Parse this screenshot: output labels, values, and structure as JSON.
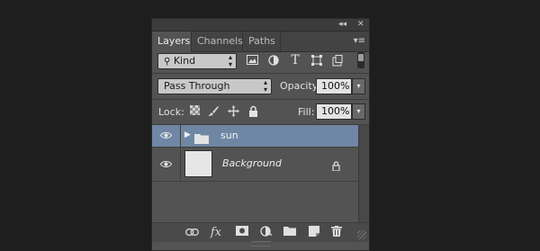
{
  "panel": {
    "title_controls": {
      "collapse": "◂◂",
      "close": "✕"
    },
    "tabs": [
      {
        "label": "Layers",
        "active": true
      },
      {
        "label": "Channels",
        "active": false
      },
      {
        "label": "Paths",
        "active": false
      }
    ],
    "menu_icon": "≡"
  },
  "filter": {
    "kind_label": "Kind",
    "icons": [
      "image-filter-icon",
      "adjustment-filter-icon",
      "type-filter-icon",
      "shape-filter-icon",
      "smart-object-filter-icon",
      "filter-toggle-icon"
    ]
  },
  "blend": {
    "mode": "Pass Through",
    "opacity_label": "Opacity:",
    "opacity_value": "100%"
  },
  "lock": {
    "label": "Lock:",
    "fill_label": "Fill:",
    "fill_value": "100%"
  },
  "layers": [
    {
      "name": "sun",
      "type": "group",
      "selected": true,
      "visible": true
    },
    {
      "name": "Background",
      "type": "background",
      "selected": false,
      "visible": true,
      "locked": true
    }
  ],
  "bottom_icons": [
    "link-layers-icon",
    "fx-icon",
    "mask-icon",
    "adjustment-icon",
    "new-group-icon",
    "new-layer-icon",
    "trash-icon"
  ],
  "bottom_fx_label": "fx",
  "colors": {
    "background": "#1e1e1e",
    "panel": "#535353",
    "selected_layer": "#6f87a4"
  }
}
